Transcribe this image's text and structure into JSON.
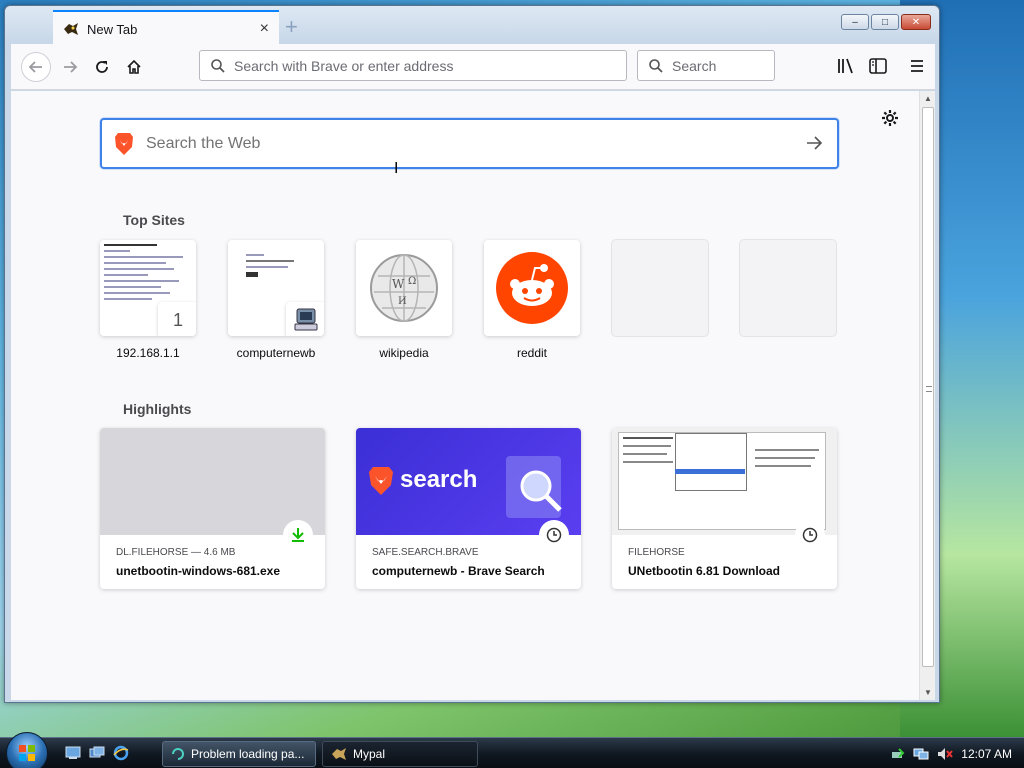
{
  "browser": {
    "tab": {
      "title": "New Tab",
      "close_glyph": "×"
    },
    "new_tab_glyph": "+",
    "window_controls": {
      "minimize": "–",
      "maximize": "□",
      "close": "✕"
    },
    "address_placeholder": "Search with Brave or enter address",
    "search_placeholder": "Search",
    "icons": [
      "back-arrow-icon",
      "forward-arrow-icon",
      "reload-icon",
      "home-icon",
      "library-icon",
      "sidebar-icon",
      "menu-icon"
    ]
  },
  "newtab": {
    "search_placeholder": "Search the Web",
    "top_sites_title": "Top Sites",
    "top_sites": [
      {
        "label": "192.168.1.1",
        "badge": "1"
      },
      {
        "label": "computernewb"
      },
      {
        "label": "wikipedia"
      },
      {
        "label": "reddit"
      },
      {
        "label": ""
      },
      {
        "label": ""
      }
    ],
    "highlights_title": "Highlights",
    "highlights": [
      {
        "source": "DL.FILEHORSE — 4.6 MB",
        "title": "unetbootin-windows-681.exe",
        "icon": "download-icon"
      },
      {
        "source": "SAFE.SEARCH.BRAVE",
        "title": "computernewb - Brave Search",
        "image_text": "search",
        "icon": "clock-icon"
      },
      {
        "source": "FILEHORSE",
        "title": "UNetbootin 6.81 Download",
        "icon": "clock-icon"
      }
    ]
  },
  "taskbar": {
    "buttons": [
      {
        "label": "Problem loading pa..."
      },
      {
        "label": "Mypal"
      }
    ],
    "clock": "12:07 AM"
  },
  "colors": {
    "accent": "#0a84ff",
    "search_border": "#3f83e8",
    "brave_orange": "#fb542b",
    "reddit_orange": "#ff4500",
    "brave_search_purple": "#3b2fd6",
    "download_green": "#12bc00"
  }
}
